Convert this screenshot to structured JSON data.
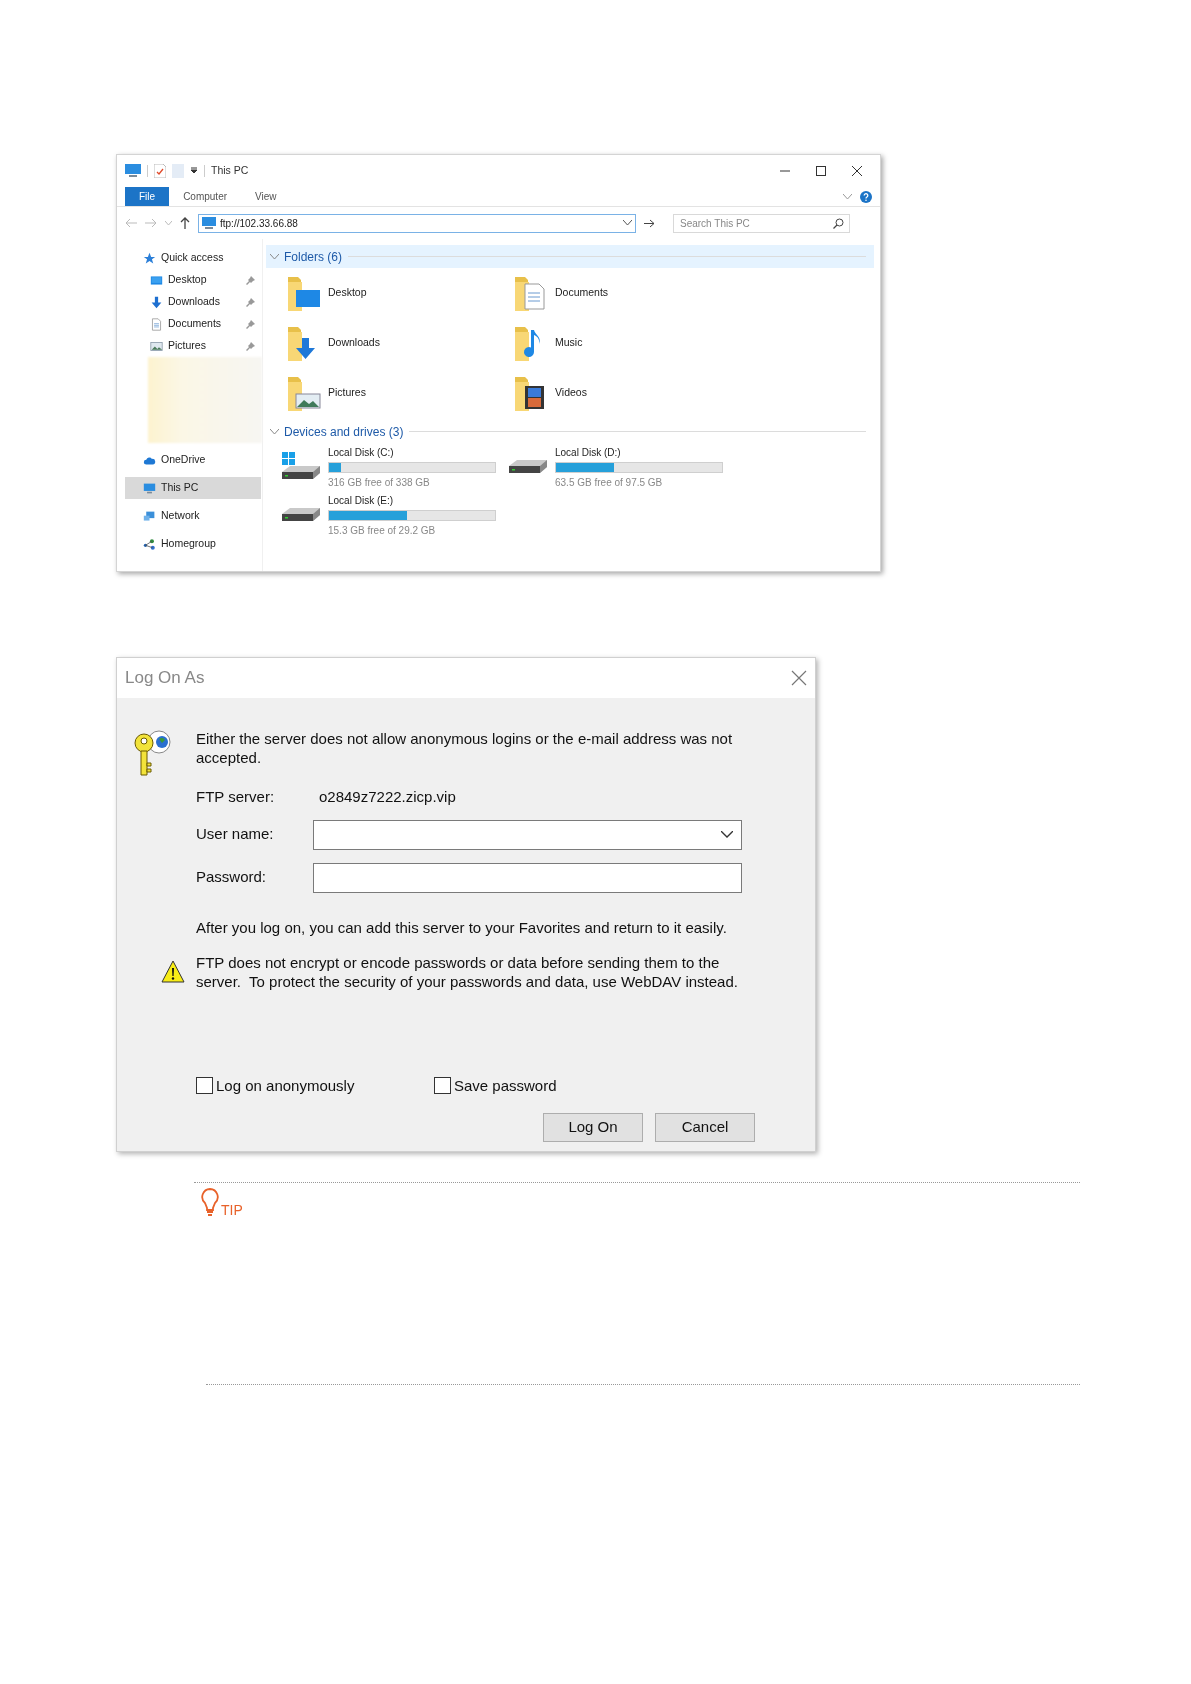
{
  "explorer": {
    "title": "This PC",
    "ribbon_tabs": [
      {
        "label": "File",
        "selected": true
      },
      {
        "label": "Computer",
        "selected": false
      },
      {
        "label": "View",
        "selected": false
      }
    ],
    "address": "ftp://102.33.66.88",
    "search": {
      "placeholder": "Search This PC"
    },
    "nav": [
      {
        "label": "Quick access",
        "kind": "star",
        "selected": false,
        "children": [
          {
            "label": "Desktop",
            "kind": "desktop",
            "pinned": true,
            "selected": false
          },
          {
            "label": "Downloads",
            "kind": "downloads",
            "pinned": true,
            "selected": false
          },
          {
            "label": "Documents",
            "kind": "documents",
            "pinned": true,
            "selected": false
          },
          {
            "label": "Pictures",
            "kind": "pictures",
            "pinned": true,
            "selected": false
          }
        ]
      },
      {
        "label": "OneDrive",
        "kind": "cloud",
        "selected": false
      },
      {
        "label": "This PC",
        "kind": "pc",
        "selected": true
      },
      {
        "label": "Network",
        "kind": "network",
        "selected": false
      },
      {
        "label": "Homegroup",
        "kind": "homegroup",
        "selected": false
      }
    ],
    "groups": [
      {
        "title": "Folders (6)",
        "kind": "folders",
        "expanded": true,
        "items": [
          {
            "label": "Desktop",
            "kind": "desktop"
          },
          {
            "label": "Documents",
            "kind": "documents"
          },
          {
            "label": "Downloads",
            "kind": "downloads"
          },
          {
            "label": "Music",
            "kind": "music"
          },
          {
            "label": "Pictures",
            "kind": "pictures"
          },
          {
            "label": "Videos",
            "kind": "videos"
          }
        ]
      },
      {
        "title": "Devices and drives (3)",
        "kind": "drives",
        "expanded": true,
        "items": [
          {
            "label": "Local Disk (C:)",
            "kind": "system",
            "level": 0.07,
            "free": "316 GB free of 338 GB"
          },
          {
            "label": "Local Disk (D:)",
            "kind": "disk",
            "level": 0.35,
            "free": "63.5 GB free of 97.5 GB"
          },
          {
            "label": "Local Disk (E:)",
            "kind": "disk",
            "level": 0.47,
            "free": "15.3 GB free of 29.2 GB"
          }
        ]
      }
    ]
  },
  "dialog": {
    "title": "Log On As",
    "message": "Either the server does not allow anonymous logins or the e-mail address was not accepted.",
    "fields": [
      {
        "kind": "static",
        "label": "FTP server:",
        "value": "o2849z7222.zicp.vip"
      },
      {
        "kind": "combo",
        "label": "User name:"
      },
      {
        "kind": "password",
        "label": "Password:"
      }
    ],
    "info": "After you log on, you can add this server to your Favorites and return to it easily.",
    "warning": "FTP does not encrypt or encode passwords or data before sending them to the server.  To protect the security of your passwords and data, use WebDAV instead.",
    "checkboxes": [
      {
        "label": "Log on anonymously",
        "checked": false
      },
      {
        "label": "Save password",
        "checked": false
      }
    ],
    "buttons": [
      {
        "label": "Log On"
      },
      {
        "label": "Cancel"
      }
    ]
  },
  "tip": {
    "label": "TIP"
  }
}
